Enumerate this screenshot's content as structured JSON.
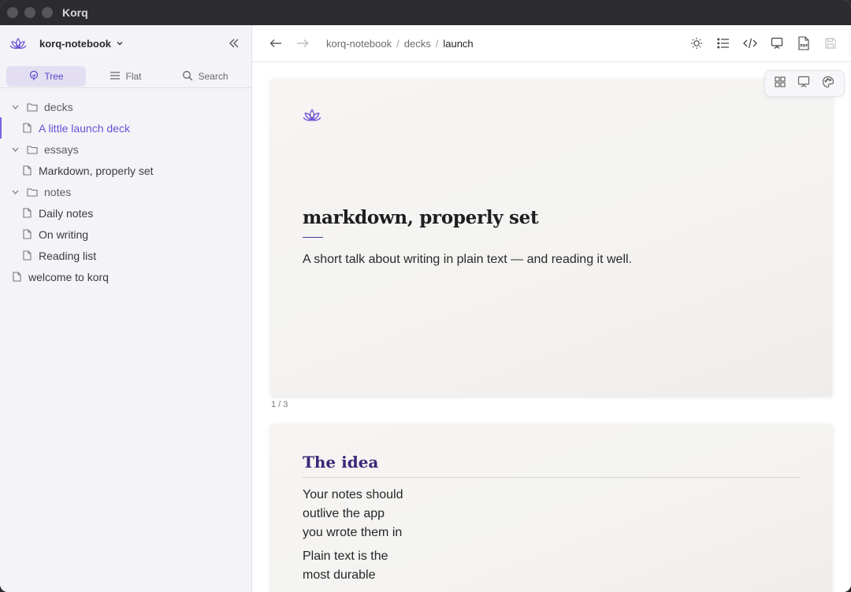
{
  "window": {
    "title": "Korq"
  },
  "sidebar": {
    "notebook": "korq-notebook",
    "modes": [
      {
        "label": "Tree",
        "icon": "tree-icon",
        "active": true
      },
      {
        "label": "Flat",
        "icon": "list-icon",
        "active": false
      },
      {
        "label": "Search",
        "icon": "search-icon",
        "active": false
      }
    ],
    "tree": [
      {
        "type": "folder",
        "label": "decks"
      },
      {
        "type": "file",
        "label": "A little launch deck",
        "active": true
      },
      {
        "type": "folder",
        "label": "essays"
      },
      {
        "type": "file",
        "label": "Markdown, properly set"
      },
      {
        "type": "folder",
        "label": "notes"
      },
      {
        "type": "file",
        "label": "Daily notes"
      },
      {
        "type": "file",
        "label": "On writing"
      },
      {
        "type": "file",
        "label": "Reading list"
      },
      {
        "type": "file",
        "label": "welcome to korq"
      }
    ]
  },
  "toolbar": {
    "breadcrumb": [
      "korq-notebook",
      "decks",
      "launch"
    ],
    "tools": [
      "theme-icon",
      "outline-icon",
      "source-icon",
      "present-icon",
      "pdf-icon",
      "save-icon"
    ]
  },
  "slides": {
    "slide1": {
      "title": "markdown, properly set",
      "subtitle": "A short talk about writing in plain text — and reading it well.",
      "counter": "1 / 3"
    },
    "slide2": {
      "title": "The idea",
      "para1": "Your notes should outlive the app you wrote them in",
      "para2": "Plain text is the most durable"
    }
  },
  "colors": {
    "accent": "#6a52d6",
    "slide_bg": "#f5f4f2"
  }
}
